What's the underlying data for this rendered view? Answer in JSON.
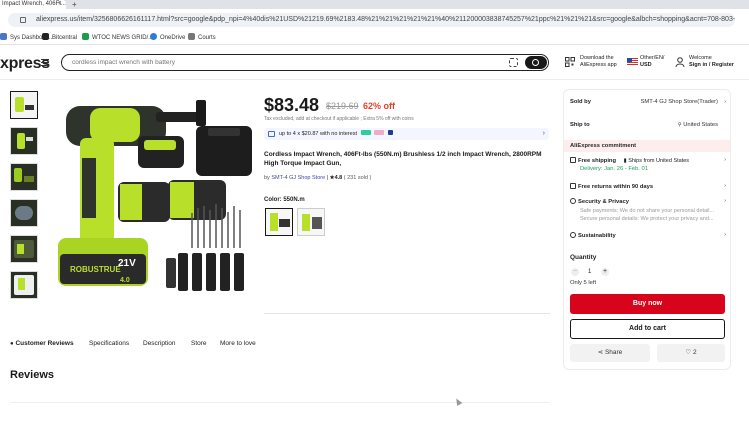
{
  "browser": {
    "tab_title": "Impact Wrench, 406Ft...",
    "tab_close": "×",
    "tab_new": "+",
    "url": "aliexpress.us/item/3256806626161117.html?src=google&pdp_npi=4%40dis%21USD%21219.69%2183.48%21%21%21%21%21%40%211200003838745257%21ppc%21%21%21&src=google&albch=shopping&acnt=708-803-3821&isdl=y&isln...",
    "bookmarks": [
      {
        "label": "Sys Dashboar...",
        "color": "#4a76c9"
      },
      {
        "label": "Bitcentral",
        "color": "#222222"
      },
      {
        "label": "WTOC NEWS GRID/...",
        "color": "#1a9c4c"
      },
      {
        "label": "OneDrive",
        "color": "#2b7cd3"
      },
      {
        "label": "Courts",
        "color": "#777777"
      }
    ]
  },
  "header": {
    "logo": "xpress",
    "search_placeholder": "cordless impact wrench with battery",
    "app_line1": "Download the",
    "app_line2": "AliExpress app",
    "locale_line1": "Other/EN/",
    "locale_line2": "USD",
    "account_line1": "Welcome",
    "account_line2": "Sign in / Register"
  },
  "product": {
    "price": "$83.48",
    "old_price": "$219.69",
    "discount": "62% off",
    "tax_note": "Tax excluded, add at checkout if applicable ; Extra 5% off with coins",
    "installment": "up to 4 x $20.87 with no interest",
    "title": "Cordless Impact Wrench, 406Ft-lbs (550N.m) Brushless 1/2 inch Impact Wrench, 2800RPM High Torque Impact Gun,",
    "store_prefix": "by",
    "store_name": "SMT-4 GJ Shop Store",
    "rating": "★4.8",
    "sold": "( 231 sold )",
    "color_label": "Color: 550N.m"
  },
  "tabs": [
    {
      "label": "Customer Reviews",
      "active": true
    },
    {
      "label": "Specifications",
      "active": false
    },
    {
      "label": "Description",
      "active": false
    },
    {
      "label": "Store",
      "active": false
    },
    {
      "label": "More to love",
      "active": false
    }
  ],
  "reviews_heading": "Reviews",
  "panel": {
    "sold_by_label": "Sold by",
    "sold_by_value": "SMT-4 GJ Shop Store(Trader)",
    "ship_to_label": "Ship to",
    "ship_to_value": "United States",
    "commitment": "AliExpress commitment",
    "free_shipping": "Free shipping",
    "ships_from": "Ships from United States",
    "delivery": "Delivery: Jan. 26 - Feb. 01",
    "free_returns": "Free returns within 90 days",
    "security": "Security & Privacy",
    "security_sub1": "Safe payments: We do not share your personal detail...",
    "security_sub2": "Secure personal details: We protect your privacy and...",
    "sustainability": "Sustainability",
    "quantity_label": "Quantity",
    "quantity": "1",
    "qty_minus": "−",
    "qty_plus": "+",
    "only_left": "Only 5 left",
    "buy_now": "Buy now",
    "add_to_cart": "Add to cart",
    "share": "Share",
    "wishlist_count": "2"
  },
  "colors": {
    "accent_red": "#d8041b",
    "discount_red": "#e2412c",
    "product_green": "#b8e02a"
  }
}
